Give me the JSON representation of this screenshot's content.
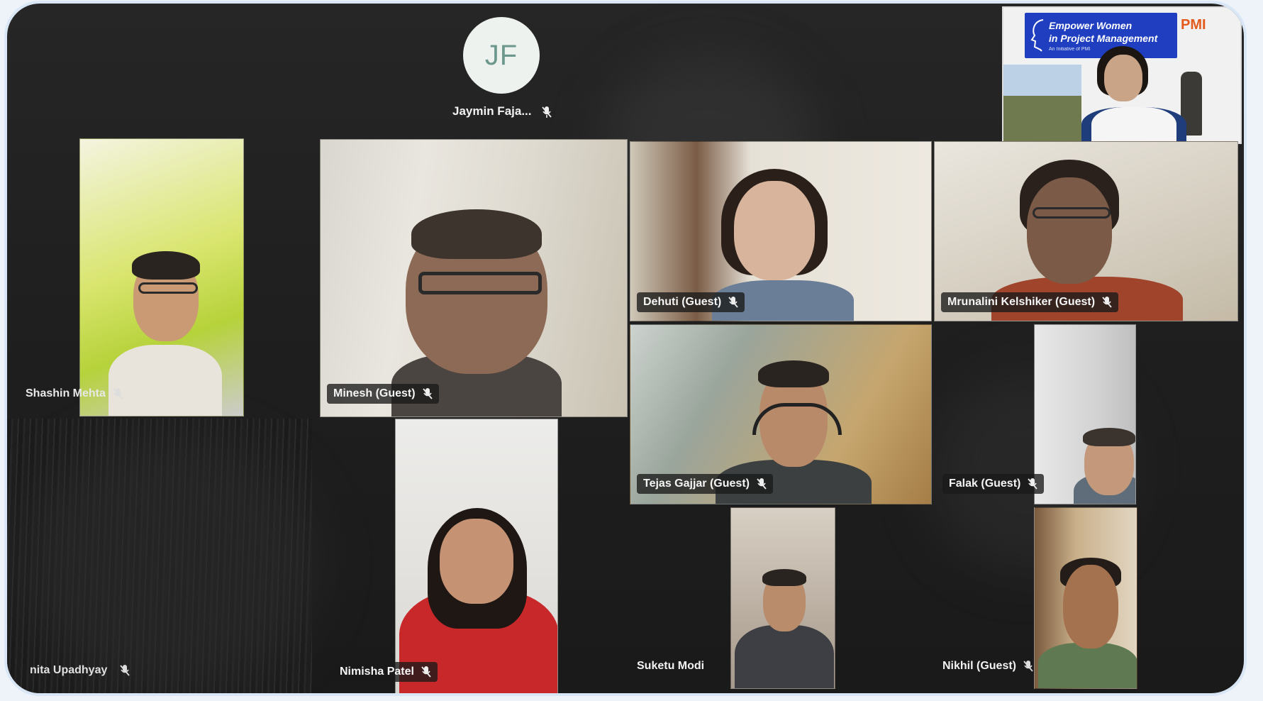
{
  "top_avatar": {
    "initials": "JF",
    "name": "Jaymin Faja..."
  },
  "presenter": {
    "banner_line1": "Empower Women",
    "banner_line2": "in Project Management",
    "banner_line3": "An Initiative of PMI",
    "logo": "PMI"
  },
  "participants": [
    {
      "id": "shashin",
      "name": "Shashin Mehta"
    },
    {
      "id": "minesh",
      "name": "Minesh (Guest)"
    },
    {
      "id": "dehuti",
      "name": "Dehuti (Guest)"
    },
    {
      "id": "mrunalini",
      "name": "Mrunalini Kelshiker (Guest)"
    },
    {
      "id": "tejas",
      "name": "Tejas Gajjar (Guest)"
    },
    {
      "id": "falak",
      "name": "Falak (Guest)"
    },
    {
      "id": "nimisha",
      "name": "Nimisha Patel"
    },
    {
      "id": "suketu",
      "name": "Suketu Modi"
    },
    {
      "id": "nikhil",
      "name": "Nikhil (Guest)"
    },
    {
      "id": "anita",
      "name": "nita Upadhyay"
    }
  ],
  "icons": {
    "muted": "mic-off-icon"
  },
  "colors": {
    "tile_label_bg": "#191919",
    "avatar_bg": "#eef2ef",
    "avatar_text": "#6c978c",
    "banner": "#1f3fc0"
  }
}
